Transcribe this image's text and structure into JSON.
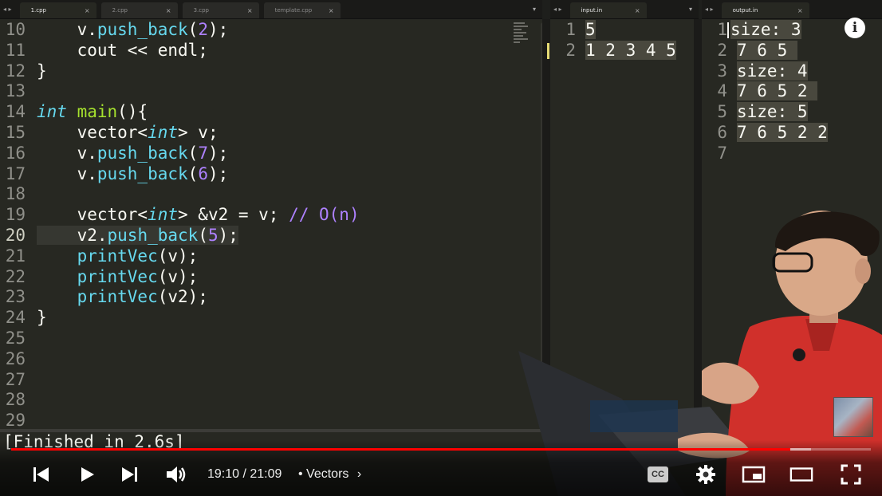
{
  "editor": {
    "tabs_left": [
      {
        "label": "1.cpp",
        "active": true
      },
      {
        "label": "2.cpp",
        "active": false
      },
      {
        "label": "3.cpp",
        "active": false
      },
      {
        "label": "template.cpp",
        "active": false
      }
    ],
    "tab_input": {
      "label": "input.in"
    },
    "tab_output": {
      "label": "output.in"
    },
    "tab_close_glyph": "×",
    "nav_arrows": "◂ ▸",
    "dropdown_glyph": "▾",
    "code_lines": [
      {
        "n": "10",
        "text": "    v.push_back(2);"
      },
      {
        "n": "11",
        "text": "    cout << endl;"
      },
      {
        "n": "12",
        "text": "}"
      },
      {
        "n": "13",
        "text": ""
      },
      {
        "n": "14",
        "text": "int main(){"
      },
      {
        "n": "15",
        "text": "    vector<int> v;"
      },
      {
        "n": "16",
        "text": "    v.push_back(7);"
      },
      {
        "n": "17",
        "text": "    v.push_back(6);"
      },
      {
        "n": "18",
        "text": ""
      },
      {
        "n": "19",
        "text": "    vector<int> &v2 = v; // O(n)"
      },
      {
        "n": "20",
        "text": "    v2.push_back(5);"
      },
      {
        "n": "21",
        "text": "    printVec(v);"
      },
      {
        "n": "22",
        "text": "    printVec(v);"
      },
      {
        "n": "23",
        "text": "    printVec(v2);"
      },
      {
        "n": "24",
        "text": "}"
      },
      {
        "n": "25",
        "text": ""
      },
      {
        "n": "26",
        "text": ""
      },
      {
        "n": "27",
        "text": ""
      },
      {
        "n": "28",
        "text": ""
      },
      {
        "n": "29",
        "text": ""
      }
    ],
    "input_lines": [
      {
        "n": "1",
        "text": "5"
      },
      {
        "n": "2",
        "text": "1 2 3 4 5"
      }
    ],
    "output_lines": [
      {
        "n": "1",
        "text": "size: 3"
      },
      {
        "n": "2",
        "text": "7 6 5 "
      },
      {
        "n": "3",
        "text": "size: 4"
      },
      {
        "n": "4",
        "text": "7 6 5 2 "
      },
      {
        "n": "5",
        "text": "size: 5"
      },
      {
        "n": "6",
        "text": "7 6 5 2 2"
      },
      {
        "n": "7",
        "text": ""
      }
    ],
    "build_status": "[Finished in 2.6s]"
  },
  "player": {
    "time_current": "19:10",
    "time_total": "21:09",
    "time_label": "19:10 / 21:09",
    "chapter_label": "• Vectors",
    "progress_fraction": 0.906,
    "buffer_fraction": 0.93,
    "info_glyph": "i",
    "icons": [
      "previous-icon",
      "play-icon",
      "next-icon",
      "volume-icon",
      "captions-icon",
      "settings-icon",
      "miniplayer-icon",
      "theater-icon",
      "fullscreen-icon"
    ],
    "captions_label": "CC"
  },
  "colors": {
    "progress": "#ff0000",
    "keyword": "#66d9ef",
    "function": "#a6e22e",
    "number": "#ae81ff",
    "background": "#272822"
  }
}
